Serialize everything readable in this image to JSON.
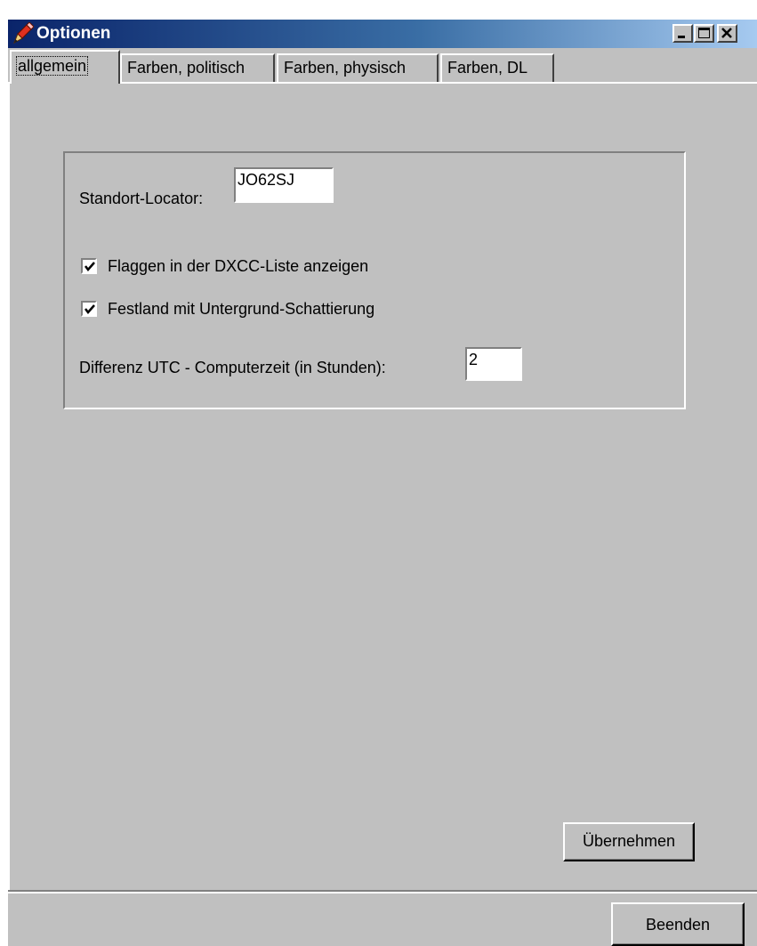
{
  "window": {
    "title": "Optionen",
    "icon": "pencil-icon",
    "controls": [
      "minimize-icon",
      "maximize-icon",
      "close-icon"
    ]
  },
  "tabs": [
    {
      "label": "allgemein",
      "active": true
    },
    {
      "label": "Farben, politisch",
      "active": false
    },
    {
      "label": "Farben, physisch",
      "active": false
    },
    {
      "label": "Farben, DL",
      "active": false
    }
  ],
  "general": {
    "locator_label": "Standort-Locator:",
    "locator_value": "JO62SJ",
    "flags_label": "Flaggen in der DXCC-Liste anzeigen",
    "flags_checked": true,
    "mainland_label": "Festland mit Untergrund-Schattierung",
    "mainland_checked": true,
    "utc_label": "Differenz UTC - Computerzeit (in Stunden):",
    "utc_value": "2"
  },
  "buttons": {
    "apply": "Übernehmen",
    "close": "Beenden"
  }
}
